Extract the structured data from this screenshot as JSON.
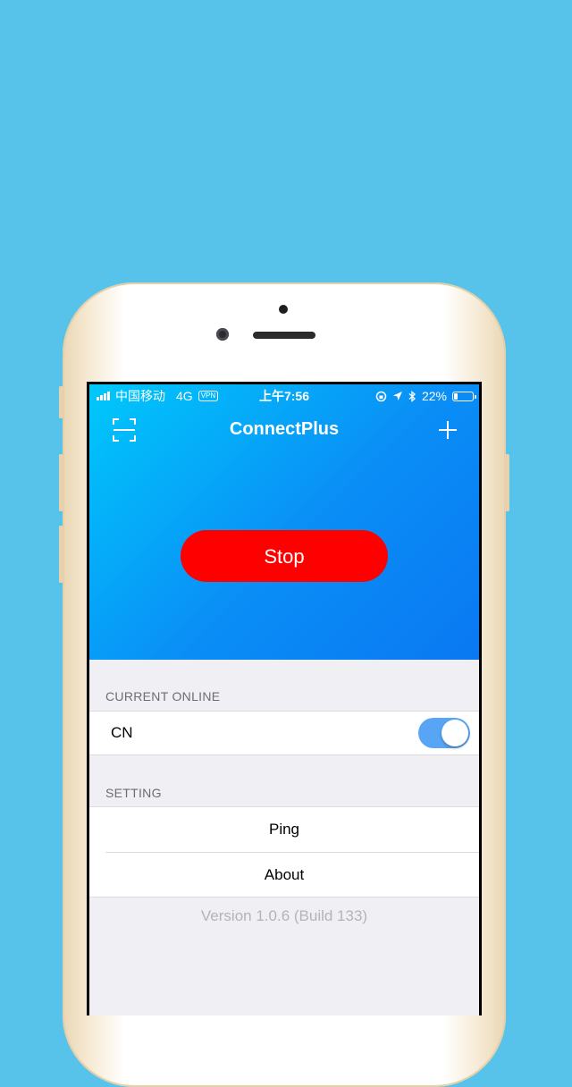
{
  "status_bar": {
    "carrier": "中国移动",
    "network": "4G",
    "vpn_badge": "VPN",
    "time": "上午7:56",
    "battery_percent": "22%",
    "battery_level": 0.22
  },
  "nav": {
    "title": "ConnectPlus",
    "left_icon": "scan-icon",
    "right_icon": "plus-icon"
  },
  "main": {
    "stop_label": "Stop",
    "stop_color": "#ff0000"
  },
  "current_online": {
    "header": "CURRENT ONLINE",
    "item_label": "CN",
    "toggle_on": true
  },
  "setting": {
    "header": "SETTING",
    "items": [
      {
        "label": "Ping"
      },
      {
        "label": "About"
      }
    ]
  },
  "footer": {
    "version": "Version 1.0.6 (Build 133)"
  },
  "colors": {
    "page_background": "#58c3ea",
    "hero_gradient_start": "#00c8fb",
    "hero_gradient_end": "#0a78f2",
    "toggle_on": "#58a5f5"
  }
}
